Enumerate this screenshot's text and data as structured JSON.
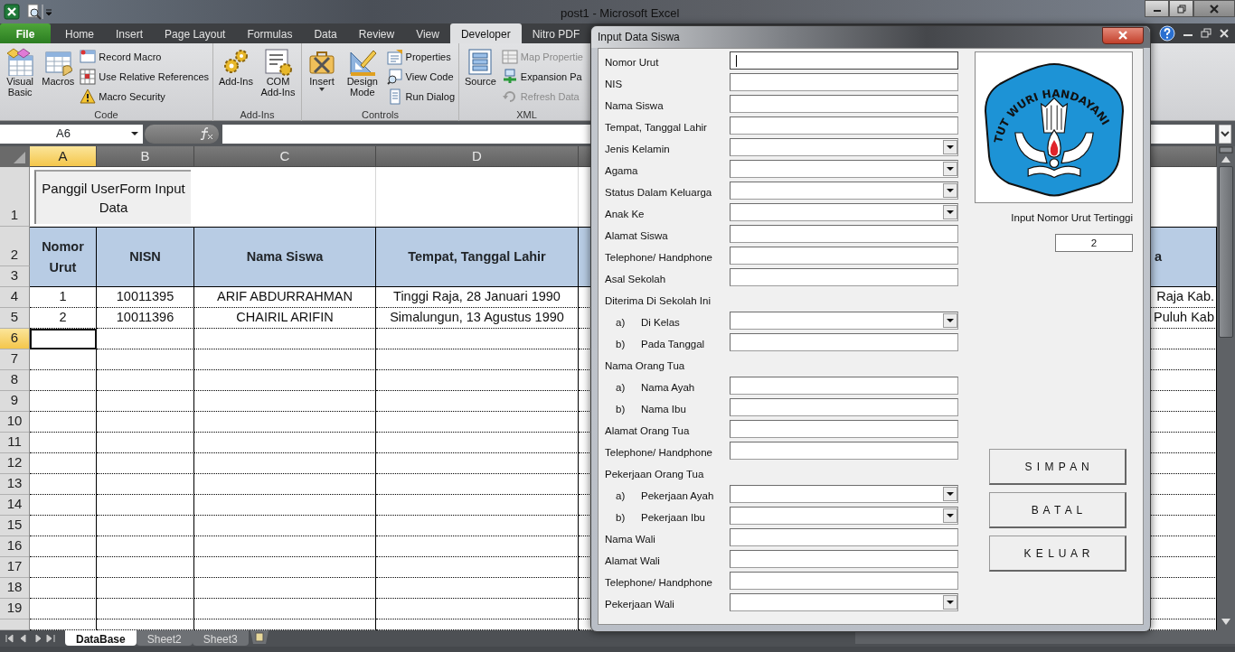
{
  "app": {
    "title": "post1 - Microsoft Excel"
  },
  "ribbon": {
    "file_tab": "File",
    "tabs": [
      {
        "label": "Home",
        "selected": false
      },
      {
        "label": "Insert",
        "selected": false
      },
      {
        "label": "Page Layout",
        "selected": false
      },
      {
        "label": "Formulas",
        "selected": false
      },
      {
        "label": "Data",
        "selected": false
      },
      {
        "label": "Review",
        "selected": false
      },
      {
        "label": "View",
        "selected": false
      },
      {
        "label": "Developer",
        "selected": true
      },
      {
        "label": "Nitro PDF",
        "selected": false
      }
    ],
    "groups": [
      {
        "label": "Code",
        "large_buttons": [
          {
            "label": "Visual Basic",
            "dropdown": false
          },
          {
            "label": "Macros",
            "dropdown": false
          }
        ],
        "small_buttons": [
          {
            "label": "Record Macro",
            "disabled": false
          },
          {
            "label": "Use Relative References",
            "disabled": false
          },
          {
            "label": "Macro Security",
            "disabled": false
          }
        ]
      },
      {
        "label": "Add-Ins",
        "large_buttons": [
          {
            "label": "Add-Ins",
            "dropdown": false
          },
          {
            "label": "COM Add-Ins",
            "dropdown": false
          }
        ]
      },
      {
        "label": "Controls",
        "large_buttons": [
          {
            "label": "Insert",
            "dropdown": true
          },
          {
            "label": "Design Mode",
            "dropdown": false
          }
        ],
        "small_buttons": [
          {
            "label": "Properties",
            "disabled": false
          },
          {
            "label": "View Code",
            "disabled": false
          },
          {
            "label": "Run Dialog",
            "disabled": false
          }
        ]
      },
      {
        "label": "XML",
        "large_buttons": [
          {
            "label": "Source",
            "dropdown": false
          }
        ],
        "small_buttons": [
          {
            "label": "Map Propertie",
            "disabled": true
          },
          {
            "label": "Expansion Pa",
            "disabled": false
          },
          {
            "label": "Refresh Data",
            "disabled": true
          }
        ]
      }
    ]
  },
  "formula_bar": {
    "name_box": "A6"
  },
  "sheet": {
    "columns": [
      {
        "letter": "A",
        "selected": true
      },
      {
        "letter": "B",
        "selected": false
      },
      {
        "letter": "C",
        "selected": false
      },
      {
        "letter": "D",
        "selected": false
      }
    ],
    "rows": [
      {
        "number": "1",
        "kind": "macro",
        "selected": false,
        "button": "Panggil UserForm Input Data"
      },
      {
        "number": "2",
        "kind": "header",
        "selected": false,
        "cells": [
          "Nomor Urut",
          "NISN",
          "Nama Siswa",
          "Tempat, Tanggal Lahir",
          "a"
        ]
      },
      {
        "number": "3",
        "kind": "merged",
        "selected": false
      },
      {
        "number": "4",
        "kind": "data",
        "selected": false,
        "cells": [
          "1",
          "10011395",
          "ARIF ABDURRAHMAN",
          "Tinggi Raja, 28 Januari 1990",
          "Raja Kab."
        ]
      },
      {
        "number": "5",
        "kind": "data",
        "selected": false,
        "cells": [
          "2",
          "10011396",
          "CHAIRIL ARIFIN",
          "Simalungun, 13 Agustus 1990",
          "Puluh Kab"
        ]
      },
      {
        "number": "6",
        "kind": "data",
        "selected": true
      },
      {
        "number": "7",
        "kind": "data",
        "selected": false
      },
      {
        "number": "8",
        "kind": "data",
        "selected": false
      },
      {
        "number": "9",
        "kind": "data",
        "selected": false
      },
      {
        "number": "10",
        "kind": "data",
        "selected": false
      },
      {
        "number": "11",
        "kind": "data",
        "selected": false
      },
      {
        "number": "12",
        "kind": "data",
        "selected": false
      },
      {
        "number": "13",
        "kind": "data",
        "selected": false
      },
      {
        "number": "14",
        "kind": "data",
        "selected": false
      },
      {
        "number": "15",
        "kind": "data",
        "selected": false
      },
      {
        "number": "16",
        "kind": "data",
        "selected": false
      },
      {
        "number": "17",
        "kind": "data",
        "selected": false
      },
      {
        "number": "18",
        "kind": "data",
        "selected": false
      },
      {
        "number": "19",
        "kind": "data",
        "selected": false
      }
    ]
  },
  "sheet_tabs": [
    {
      "label": "DataBase",
      "selected": true
    },
    {
      "label": "Sheet2",
      "selected": false
    },
    {
      "label": "Sheet3",
      "selected": false
    }
  ],
  "dialog": {
    "title": "Input Data Siswa",
    "fields": [
      {
        "label": "Nomor Urut",
        "kind": "text",
        "focused": true
      },
      {
        "label": "NIS",
        "kind": "text",
        "focused": false
      },
      {
        "label": "Nama Siswa",
        "kind": "text",
        "focused": false
      },
      {
        "label": "Tempat, Tanggal Lahir",
        "kind": "text",
        "focused": false
      },
      {
        "label": "Jenis Kelamin",
        "kind": "combo",
        "focused": false
      },
      {
        "label": "Agama",
        "kind": "combo",
        "focused": false
      },
      {
        "label": "Status Dalam Keluarga",
        "kind": "combo",
        "focused": false
      },
      {
        "label": "Anak Ke",
        "kind": "combo",
        "focused": false
      },
      {
        "label": "Alamat Siswa",
        "kind": "text",
        "focused": false
      },
      {
        "label": "Telephone/ Handphone",
        "kind": "text",
        "focused": false
      },
      {
        "label": "Asal Sekolah",
        "kind": "text",
        "focused": false
      },
      {
        "label": "Diterima Di Sekolah Ini",
        "kind": "heading"
      },
      {
        "marker": "a)",
        "label": "Di Kelas",
        "kind": "combo",
        "focused": false
      },
      {
        "marker": "b)",
        "label": "Pada Tanggal",
        "kind": "text",
        "focused": false
      },
      {
        "label": "Nama Orang Tua",
        "kind": "heading"
      },
      {
        "marker": "a)",
        "label": "Nama Ayah",
        "kind": "text",
        "focused": false
      },
      {
        "marker": "b)",
        "label": "Nama Ibu",
        "kind": "text",
        "focused": false
      },
      {
        "label": "Alamat Orang Tua",
        "kind": "text",
        "focused": false
      },
      {
        "label": "Telephone/ Handphone",
        "kind": "text",
        "focused": false
      },
      {
        "label": "Pekerjaan Orang Tua",
        "kind": "heading"
      },
      {
        "marker": "a)",
        "label": "Pekerjaan Ayah",
        "kind": "combo",
        "focused": false
      },
      {
        "marker": "b)",
        "label": "Pekerjaan Ibu",
        "kind": "combo",
        "focused": false
      },
      {
        "label": "Nama Wali",
        "kind": "text",
        "focused": false
      },
      {
        "label": "Alamat Wali",
        "kind": "text",
        "focused": false
      },
      {
        "label": "Telephone/ Handphone",
        "kind": "text",
        "focused": false
      },
      {
        "label": "Pekerjaan Wali",
        "kind": "combo",
        "focused": false
      }
    ],
    "logo_text": "TUT WURI HANDAYANI",
    "max_label": "Input Nomor Urut Tertinggi",
    "max_value": "2",
    "buttons": [
      "S I M P A N",
      "B A T A L",
      "K E L U A R"
    ]
  }
}
